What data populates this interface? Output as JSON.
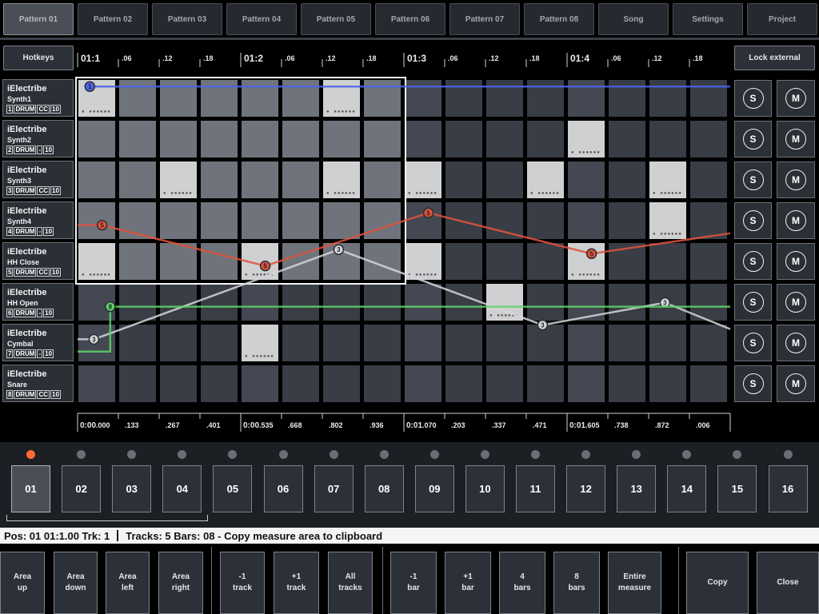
{
  "top_tabs": [
    "Pattern 01",
    "Pattern 02",
    "Pattern 03",
    "Pattern 04",
    "Pattern 05",
    "Pattern 06",
    "Pattern 07",
    "Pattern 08",
    "Song",
    "Settings",
    "Project"
  ],
  "hotkeys_label": "Hotkeys",
  "lock_external_label": "Lock external",
  "ruler": [
    "01:1",
    ".06",
    ".12",
    ".18",
    "01:2",
    ".06",
    ".12",
    ".18",
    "01:3",
    ".06",
    ".12",
    ".18",
    "01:4",
    ".06",
    ".12",
    ".18"
  ],
  "tracks": [
    {
      "name": "iElectribe",
      "sub": "Synth1",
      "num": "1",
      "type": "DRUM",
      "cc": "CC",
      "ch": "10"
    },
    {
      "name": "iElectribe",
      "sub": "Synth2",
      "num": "2",
      "type": "DRUM",
      "cc": "-",
      "ch": "10"
    },
    {
      "name": "iElectribe",
      "sub": "Synth3",
      "num": "3",
      "type": "DRUM",
      "cc": "CC",
      "ch": "10"
    },
    {
      "name": "iElectribe",
      "sub": "Synth4",
      "num": "4",
      "type": "DRUM",
      "cc": "-",
      "ch": "10"
    },
    {
      "name": "iElectribe",
      "sub": "HH Close",
      "num": "5",
      "type": "DRUM",
      "cc": "CC",
      "ch": "10"
    },
    {
      "name": "iElectribe",
      "sub": "HH Open",
      "num": "6",
      "type": "DRUM",
      "cc": "-",
      "ch": "10"
    },
    {
      "name": "iElectribe",
      "sub": "Cymbal",
      "num": "7",
      "type": "DRUM",
      "cc": "-",
      "ch": "10"
    },
    {
      "name": "iElectribe",
      "sub": "Snare",
      "num": "8",
      "type": "DRUM",
      "cc": "CC",
      "ch": "10"
    }
  ],
  "solo_label": "S",
  "mute_label": "M",
  "notes": [
    [
      0,
      0
    ],
    [
      0,
      6
    ],
    [
      1,
      12
    ],
    [
      2,
      2
    ],
    [
      2,
      6
    ],
    [
      2,
      8
    ],
    [
      2,
      11
    ],
    [
      2,
      14
    ],
    [
      3,
      14
    ],
    [
      4,
      0
    ],
    [
      4,
      4
    ],
    [
      4,
      8
    ],
    [
      4,
      12
    ],
    [
      5,
      10
    ],
    [
      6,
      4
    ]
  ],
  "curves": {
    "blue": {
      "color": "#4a64e6",
      "label": "1",
      "points": [
        [
          0.3,
          0.2
        ],
        [
          16,
          0.2
        ]
      ],
      "markers": [
        [
          0.3,
          0.2
        ]
      ]
    },
    "red": {
      "color": "#e0523d",
      "label": "5",
      "points": [
        [
          0,
          3.6
        ],
        [
          0.6,
          3.6
        ],
        [
          4.6,
          4.6
        ],
        [
          8.6,
          3.3
        ],
        [
          12.6,
          4.3
        ],
        [
          16,
          3.8
        ]
      ],
      "markers": [
        [
          0.6,
          3.6
        ],
        [
          4.6,
          4.6
        ],
        [
          8.6,
          3.3
        ],
        [
          12.6,
          4.3
        ]
      ]
    },
    "white": {
      "color": "#d4d6da",
      "label": "3",
      "points": [
        [
          0,
          6.4
        ],
        [
          0.4,
          6.4
        ],
        [
          6.4,
          4.2
        ],
        [
          11.4,
          6.05
        ],
        [
          14.4,
          5.5
        ],
        [
          16,
          6.15
        ]
      ],
      "markers": [
        [
          0.4,
          6.4
        ],
        [
          6.4,
          4.2
        ],
        [
          11.4,
          6.05
        ],
        [
          14.4,
          5.5
        ]
      ]
    },
    "green": {
      "color": "#5fd268",
      "label": "8",
      "points": [
        [
          0,
          6.7
        ],
        [
          0.8,
          6.7
        ],
        [
          0.8,
          5.6
        ],
        [
          16,
          5.6
        ]
      ],
      "markers": [
        [
          0.8,
          5.6
        ]
      ]
    }
  },
  "times": [
    {
      "t": "0:00",
      "s": ".000",
      "major": true
    },
    {
      "t": ".133"
    },
    {
      "t": ".267"
    },
    {
      "t": ".401"
    },
    {
      "t": "0:00",
      "s": ".535",
      "major": true
    },
    {
      "t": ".668"
    },
    {
      "t": ".802"
    },
    {
      "t": ".936"
    },
    {
      "t": "0:01",
      "s": ".070",
      "major": true
    },
    {
      "t": ".203"
    },
    {
      "t": ".337"
    },
    {
      "t": ".471"
    },
    {
      "t": "0:01",
      "s": ".605",
      "major": true
    },
    {
      "t": ".738"
    },
    {
      "t": ".872"
    },
    {
      "t": ".006"
    }
  ],
  "steps": [
    "01",
    "02",
    "03",
    "04",
    "05",
    "06",
    "07",
    "08",
    "09",
    "10",
    "11",
    "12",
    "13",
    "14",
    "15",
    "16"
  ],
  "active_step": 0,
  "status": {
    "left": "Pos: 01 01:1.00 Trk: 1",
    "right": "Tracks: 5 Bars: 08 - Copy measure area to clipboard"
  },
  "bottom_buttons": [
    {
      "label": "Area\nup"
    },
    {
      "label": "Area\ndown"
    },
    {
      "label": "Area\nleft"
    },
    {
      "label": "Area\nright"
    },
    {
      "label": "-1\ntrack"
    },
    {
      "label": "+1\ntrack"
    },
    {
      "label": "All\ntracks"
    },
    {
      "label": "-1\nbar"
    },
    {
      "label": "+1\nbar"
    },
    {
      "label": "4\nbars"
    },
    {
      "label": "8\nbars"
    },
    {
      "label": "Entire\nmeasure"
    },
    {
      "label": "Copy"
    },
    {
      "label": "Close"
    }
  ],
  "colors": {
    "accent": "#ff6a33",
    "selection": "#ffffff"
  }
}
